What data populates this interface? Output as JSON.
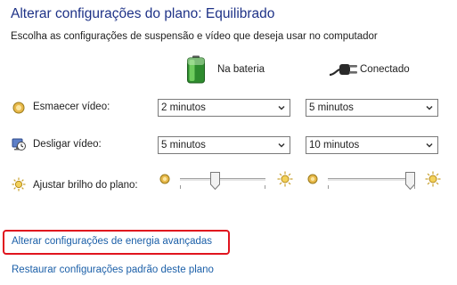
{
  "header": {
    "title": "Alterar configurações do plano: Equilibrado",
    "subtitle": "Escolha as configurações de suspensão e vídeo que deseja usar no computador"
  },
  "columns": {
    "battery": {
      "label": "Na bateria",
      "icon": "battery-icon"
    },
    "plugged": {
      "label": "Conectado",
      "icon": "power-plug-icon"
    }
  },
  "settings": [
    {
      "label": "Esmaecer vídeo:",
      "icon": "dim-display-icon",
      "battery_value": "2 minutos",
      "plugged_value": "5 minutos"
    },
    {
      "label": "Desligar vídeo:",
      "icon": "monitor-clock-icon",
      "battery_value": "5 minutos",
      "plugged_value": "10 minutos"
    }
  ],
  "brightness": {
    "label": "Ajustar brilho do plano:",
    "icon": "sun-icon",
    "battery_level": 0.4,
    "plugged_level": 1.0
  },
  "links": {
    "advanced": "Alterar configurações de energia avançadas",
    "restore": "Restaurar configurações padrão deste plano"
  },
  "colors": {
    "title": "#1e3287",
    "link": "#1b5fa8",
    "highlight": "#e0141e"
  }
}
